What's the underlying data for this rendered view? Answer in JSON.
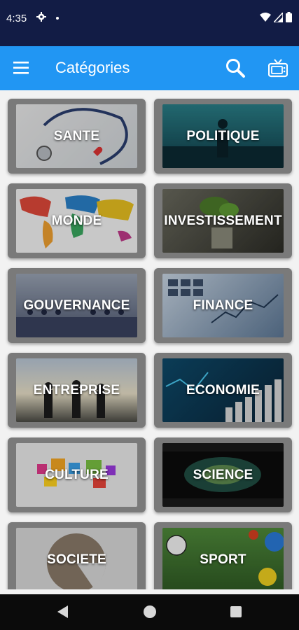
{
  "status_bar": {
    "time": "4:35"
  },
  "app_bar": {
    "title": "Catégories"
  },
  "categories": [
    {
      "label": "SANTE"
    },
    {
      "label": "POLITIQUE"
    },
    {
      "label": "MONDE"
    },
    {
      "label": "INVESTISSEMENT"
    },
    {
      "label": "GOUVERNANCE"
    },
    {
      "label": "FINANCE"
    },
    {
      "label": "ENTREPRISE"
    },
    {
      "label": "ECONOMIE"
    },
    {
      "label": "CULTURE"
    },
    {
      "label": "SCIENCE"
    },
    {
      "label": "SOCIETE"
    },
    {
      "label": "SPORT"
    }
  ],
  "colors": {
    "status_bar": "#121c45",
    "app_bar": "#2196f3",
    "card_bg": "#7a7a7a",
    "nav_bar": "#0b0b0b"
  },
  "icons": [
    "menu-icon",
    "search-icon",
    "tv-icon",
    "gear-icon",
    "wifi-icon",
    "signal-icon",
    "battery-icon",
    "back-icon",
    "home-icon",
    "recents-icon"
  ]
}
